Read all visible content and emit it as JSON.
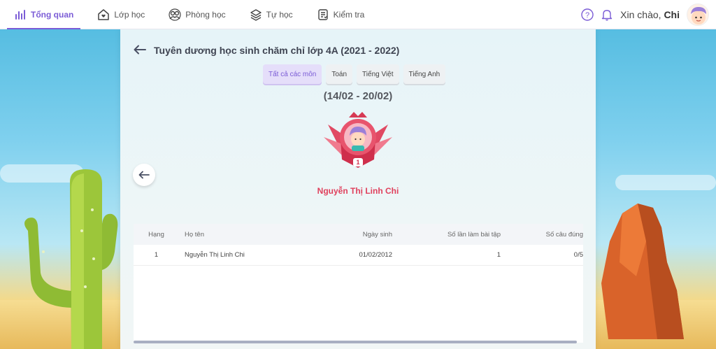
{
  "nav": {
    "items": [
      {
        "label": "Tổng quan",
        "icon": "chart-icon"
      },
      {
        "label": "Lớp học",
        "icon": "home-heart-icon"
      },
      {
        "label": "Phòng học",
        "icon": "classroom-icon"
      },
      {
        "label": "Tự học",
        "icon": "layers-icon"
      },
      {
        "label": "Kiểm tra",
        "icon": "checklist-icon"
      }
    ]
  },
  "header": {
    "greeting": "Xin chào, ",
    "username": "Chi"
  },
  "page": {
    "title": "Tuyên dương học sinh chăm chỉ lớp 4A (2021 - 2022)",
    "tabs": [
      "Tất cả các môn",
      "Toán",
      "Tiếng Việt",
      "Tiếng Anh"
    ],
    "week": "(14/02 - 20/02)",
    "badge_rank": "1",
    "winner_name": "Nguyễn Thị Linh Chi"
  },
  "table": {
    "headers": [
      "Hạng",
      "Họ tên",
      "Ngày sinh",
      "Số lần làm bài tập",
      "Số câu đúng"
    ],
    "rows": [
      [
        "1",
        "Nguyễn Thị Linh Chi",
        "01/02/2012",
        "1",
        "0/5"
      ]
    ]
  },
  "colors": {
    "accent": "#7b5cd6",
    "winner": "#e0415d"
  }
}
